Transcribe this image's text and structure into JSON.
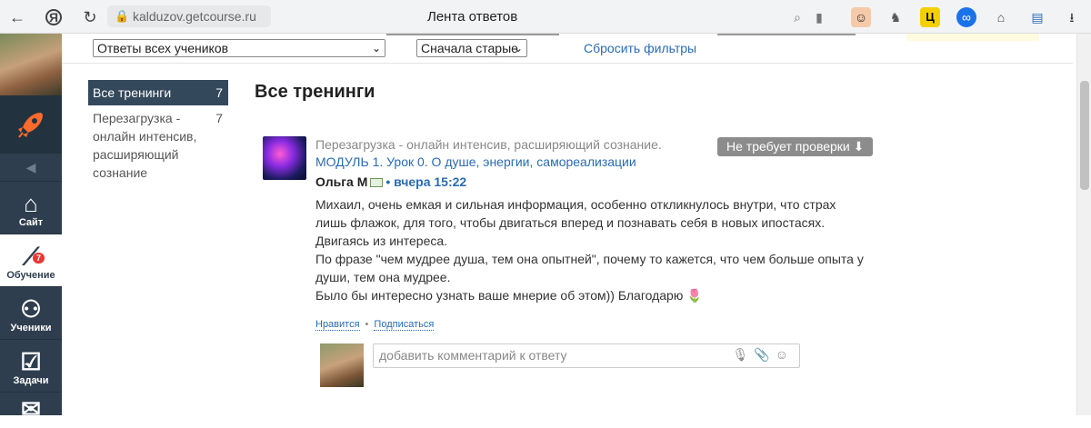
{
  "browser": {
    "url": "kalduzov.getcourse.ru",
    "tab_title": "Лента ответов",
    "yandex_letter": "Я",
    "ext_ts_letter": "Ц"
  },
  "sidebar": {
    "items": [
      {
        "label": "Сайт",
        "icon": "home-icon"
      },
      {
        "label": "Обучение",
        "icon": "chart-icon",
        "badge": "7"
      },
      {
        "label": "Ученики",
        "icon": "users-icon"
      },
      {
        "label": "Задачи",
        "icon": "checkbox-icon"
      }
    ]
  },
  "filters": {
    "students_select": "Ответы всех учеников",
    "order_select": "Сначала старые",
    "reset_link": "Сбросить фильтры"
  },
  "courses": [
    {
      "label": "Все тренинги",
      "count": "7"
    },
    {
      "label": "Перезагрузка - онлайн интенсив, расширяющий сознание",
      "count": "7"
    }
  ],
  "main": {
    "title": "Все тренинги",
    "answer": {
      "course": "Перезагрузка - онлайн интенсив, расширяющий сознание.",
      "module_link": "МОДУЛЬ 1. Урок 0. О душе, энергии, самореализации",
      "status": "Не требует проверки ⬇",
      "author": "Ольга М",
      "time": "вчера 15:22",
      "text_lines": [
        "Михаил, очень емкая и сильная информация, особенно откликнулось внутри, что страх лишь флажок, для того, чтобы двигаться вперед и познавать себя в новых ипостасях. Двигаясь из интереса.",
        "По фразе \"чем мудрее душа, тем она опытней\", почему то кажется, что чем больше опыта у души, тем она мудрее.",
        "Было бы интересно узнать ваше мнерие об этом)) Благодарю 🌷"
      ],
      "like": "Нравится",
      "subscribe": "Подписаться",
      "comment_placeholder": "добавить комментарий к ответу"
    }
  },
  "colors": {
    "sidebar_bg": "#2e3e4e",
    "link": "#2a6bb3",
    "status_bg": "#8c8c8c",
    "rocket": "#ff6b2c"
  }
}
